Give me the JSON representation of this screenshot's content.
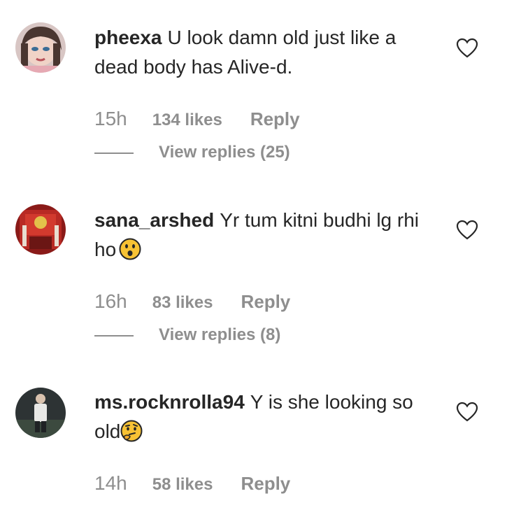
{
  "comments": [
    {
      "username": "pheexa",
      "text": "U look damn old just like a dead body has Alive-d.",
      "time": "15h",
      "likes": "134 likes",
      "reply": "Reply",
      "view_replies": "View replies (25)",
      "emoji": null,
      "avatar_icon": "profile-photo-woman"
    },
    {
      "username": "sana_arshed",
      "text": "Yr tum kitni budhi lg rhi ho",
      "time": "16h",
      "likes": "83 likes",
      "reply": "Reply",
      "view_replies": "View replies (8)",
      "emoji": "astonished-face-emoji",
      "avatar_icon": "profile-photo-red"
    },
    {
      "username": "ms.rocknrolla94",
      "text": "Y is she looking so old",
      "time": "14h",
      "likes": "58 likes",
      "reply": "Reply",
      "view_replies": null,
      "emoji": "thinking-face-emoji",
      "avatar_icon": "profile-photo-dark"
    }
  ],
  "colors": {
    "text": "#262626",
    "secondary": "#8e8e8e",
    "emoji_yellow": "#f7c234"
  }
}
